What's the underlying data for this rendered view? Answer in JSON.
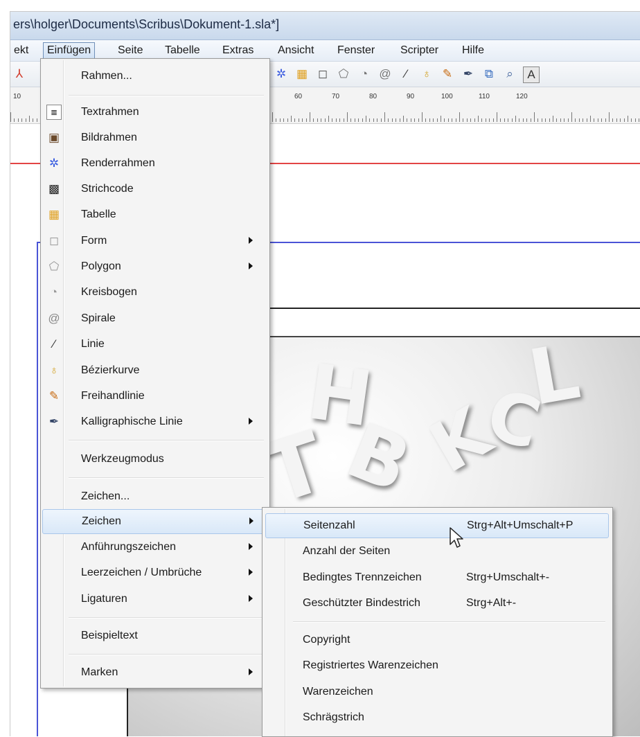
{
  "window": {
    "title": "ers\\holger\\Documents\\Scribus\\Dokument-1.sla*]"
  },
  "menubar": [
    {
      "label": "ekt",
      "active": false
    },
    {
      "label": "Einfügen",
      "active": true
    },
    {
      "label": "Seite",
      "active": false
    },
    {
      "label": "Tabelle",
      "active": false
    },
    {
      "label": "Extras",
      "active": false
    },
    {
      "label": "Ansicht",
      "active": false
    },
    {
      "label": "Fenster",
      "active": false
    },
    {
      "label": "Scripter",
      "active": false
    },
    {
      "label": "Hilfe",
      "active": false
    }
  ],
  "toolbar": {
    "icons": [
      "pdf-icon",
      "render-frame-icon",
      "table-icon",
      "shape-icon",
      "polygon-icon",
      "arc-icon",
      "spiral-icon",
      "line-icon",
      "bezier-icon",
      "freehand-icon",
      "calligraphic-icon",
      "link-icon",
      "zoom-icon",
      "text-tool-icon"
    ]
  },
  "ruler": {
    "labels": [
      "10",
      "60",
      "70",
      "80",
      "90",
      "100",
      "110",
      "120"
    ]
  },
  "insert_menu": {
    "items": [
      {
        "label": "Rahmen...",
        "icon": "",
        "submenu": false
      },
      {
        "label": "Textrahmen",
        "icon": "text-frame-icon",
        "submenu": false
      },
      {
        "label": "Bildrahmen",
        "icon": "image-frame-icon",
        "submenu": false
      },
      {
        "label": "Renderrahmen",
        "icon": "render-frame-icon",
        "submenu": false
      },
      {
        "label": "Strichcode",
        "icon": "barcode-icon",
        "submenu": false
      },
      {
        "label": "Tabelle",
        "icon": "table-icon",
        "submenu": false
      },
      {
        "label": "Form",
        "icon": "shape-icon",
        "submenu": true
      },
      {
        "label": "Polygon",
        "icon": "polygon-icon",
        "submenu": true
      },
      {
        "label": "Kreisbogen",
        "icon": "arc-icon",
        "submenu": false
      },
      {
        "label": "Spirale",
        "icon": "spiral-icon",
        "submenu": false
      },
      {
        "label": "Linie",
        "icon": "line-icon",
        "submenu": false
      },
      {
        "label": "Bézierkurve",
        "icon": "bezier-icon",
        "submenu": false
      },
      {
        "label": "Freihandlinie",
        "icon": "freehand-icon",
        "submenu": false
      },
      {
        "label": "Kalligraphische Linie",
        "icon": "calligraphic-icon",
        "submenu": true
      },
      {
        "label": "Werkzeugmodus",
        "icon": "",
        "submenu": false
      },
      {
        "label": "Zeichen...",
        "icon": "",
        "submenu": false
      },
      {
        "label": "Zeichen",
        "icon": "",
        "submenu": true,
        "highlighted": true
      },
      {
        "label": "Anführungszeichen",
        "icon": "",
        "submenu": true
      },
      {
        "label": "Leerzeichen / Umbrüche",
        "icon": "",
        "submenu": true
      },
      {
        "label": "Ligaturen",
        "icon": "",
        "submenu": true
      },
      {
        "label": "Beispieltext",
        "icon": "",
        "submenu": false
      },
      {
        "label": "Marken",
        "icon": "",
        "submenu": true
      }
    ]
  },
  "zeichen_submenu": {
    "items": [
      {
        "label": "Seitenzahl",
        "shortcut": "Strg+Alt+Umschalt+P",
        "highlighted": true
      },
      {
        "label": "Anzahl der Seiten",
        "shortcut": ""
      },
      {
        "label": "Bedingtes Trennzeichen",
        "shortcut": "Strg+Umschalt+-"
      },
      {
        "label": "Geschützter Bindestrich",
        "shortcut": "Strg+Alt+-"
      },
      {
        "label": "Copyright",
        "shortcut": ""
      },
      {
        "label": "Registriertes Warenzeichen",
        "shortcut": ""
      },
      {
        "label": "Warenzeichen",
        "shortcut": ""
      },
      {
        "label": "Schrägstrich",
        "shortcut": ""
      }
    ]
  },
  "colors": {
    "accent": "#a9c6ea",
    "guide_red": "#e34444",
    "guide_blue": "#4a54d6"
  }
}
